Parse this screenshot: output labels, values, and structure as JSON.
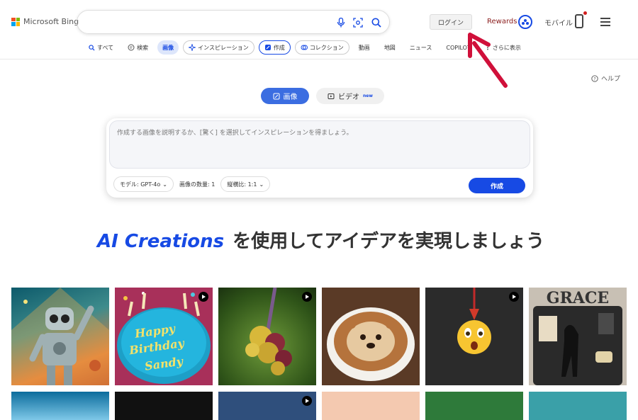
{
  "brand": {
    "name": "Microsoft Bing"
  },
  "search": {
    "placeholder": "",
    "value": ""
  },
  "header": {
    "login": "ログイン",
    "rewards": "Rewards",
    "mobile": "モバイル"
  },
  "nav": {
    "items": [
      {
        "label": "すべて",
        "icon": "search-icon"
      },
      {
        "label": "検索",
        "icon": "chat-icon"
      },
      {
        "label": "画像",
        "active": true
      },
      {
        "label": "インスピレーション",
        "icon": "sparkle-icon"
      },
      {
        "label": "作成",
        "icon": "create-icon"
      },
      {
        "label": "コレクション",
        "icon": "collection-icon"
      },
      {
        "label": "動画"
      },
      {
        "label": "地図"
      },
      {
        "label": "ニュース"
      },
      {
        "label": "COPILOT"
      },
      {
        "label": "さらに表示",
        "icon": "more-vertical-icon"
      }
    ]
  },
  "help": "ヘルプ",
  "tabs": {
    "image": "画像",
    "video": "ビデオ",
    "new_badge": "new"
  },
  "composer": {
    "placeholder": "作成する画像を説明するか、[驚く] を選択してインスピレーションを得ましょう。",
    "model": "モデル: GPT-4o",
    "count": "画像の数量: 1",
    "ratio": "縦横比: 1:1",
    "create": "作成"
  },
  "headline": {
    "highlight": "AI Creations",
    "rest": "を使用してアイデアを実現しましょう"
  },
  "gallery": {
    "tiles": [
      {
        "subject": "retro robot poster"
      },
      {
        "subject": "birthday cake",
        "text": "Happy Birthday Sandy",
        "video": true
      },
      {
        "subject": "yellow flower",
        "video": true
      },
      {
        "subject": "otter latte art"
      },
      {
        "subject": "surprised emoji",
        "video": true
      },
      {
        "subject": "dog wall art",
        "text": "GRACE"
      }
    ]
  },
  "colors": {
    "accent": "#174ae4",
    "tab_active": "#3b6de1",
    "annotation_arrow": "#d0103a"
  }
}
